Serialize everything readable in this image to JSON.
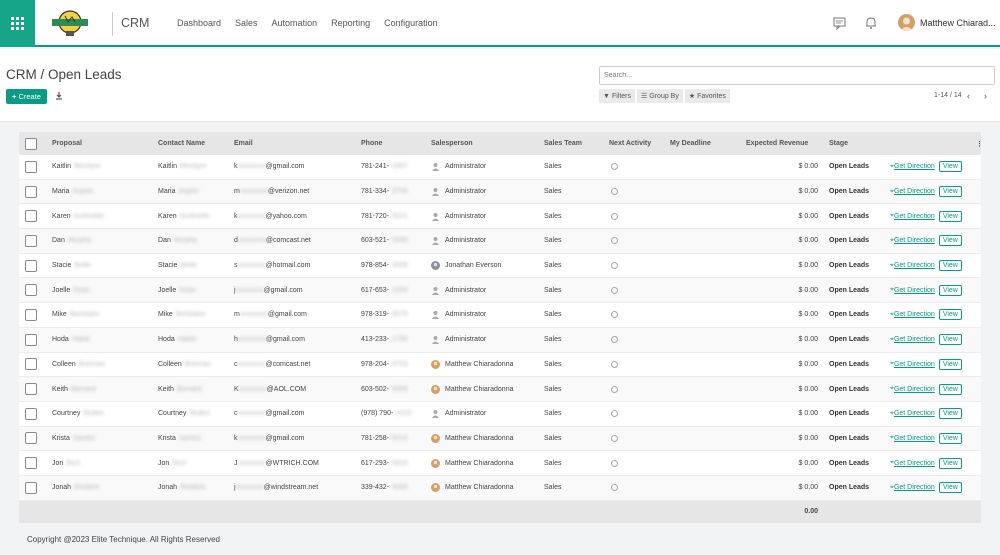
{
  "app": {
    "name": "CRM"
  },
  "nav": {
    "items": [
      "Dashboard",
      "Sales",
      "Automation",
      "Reporting",
      "Configuration"
    ]
  },
  "user": {
    "name": "Matthew Chiarad..."
  },
  "control": {
    "breadcrumb": "CRM / Open Leads",
    "create_label": "Create",
    "search_placeholder": "Search...",
    "filters_label": "Filters",
    "group_by_label": "Group By",
    "favorites_label": "Favorites",
    "pager": "1-14 / 14"
  },
  "table": {
    "columns": [
      "Proposal",
      "Contact Name",
      "Email",
      "Phone",
      "Salesperson",
      "Sales Team",
      "Next Activity",
      "My Deadline",
      "Expected Revenue",
      "Stage"
    ],
    "rows": [
      {
        "first": "Kaitlin",
        "last": "Mcintyre",
        "email_a": "k",
        "email_b": "",
        "email_c": "@gmail.com",
        "phone": "781-241-",
        "phone_b": "3307",
        "salesperson": "Administrator",
        "avatar": "default",
        "team": "Sales",
        "revenue": "$ 0.00",
        "stage": "Open Leads"
      },
      {
        "first": "Maria",
        "last": "Argolo",
        "email_a": "m",
        "email_b": "",
        "email_c": "@verizon.net",
        "phone": "781-334-",
        "phone_b": "0756",
        "salesperson": "Administrator",
        "avatar": "default",
        "team": "Sales",
        "revenue": "$ 0.00",
        "stage": "Open Leads"
      },
      {
        "first": "Karen",
        "last": "Guilmette",
        "email_a": "k",
        "email_b": "",
        "email_c": "@yahoo.com",
        "phone": "781-720-",
        "phone_b": "5021",
        "salesperson": "Administrator",
        "avatar": "default",
        "team": "Sales",
        "revenue": "$ 0.00",
        "stage": "Open Leads"
      },
      {
        "first": "Dan",
        "last": "Murphy",
        "email_a": "d",
        "email_b": "",
        "email_c": "@comcast.net",
        "phone": "603-521-",
        "phone_b": "5585",
        "salesperson": "Administrator",
        "avatar": "default",
        "team": "Sales",
        "revenue": "$ 0.00",
        "stage": "Open Leads"
      },
      {
        "first": "Stacie",
        "last": "Botte",
        "email_a": "s",
        "email_b": "",
        "email_c": "@hotmail.com",
        "phone": "978-854-",
        "phone_b": "3008",
        "salesperson": "Jonathan Everson",
        "avatar": "jonathan",
        "team": "Sales",
        "revenue": "$ 0.00",
        "stage": "Open Leads"
      },
      {
        "first": "Joelle",
        "last": "Dean",
        "email_a": "j",
        "email_b": "",
        "email_c": "@gmail.com",
        "phone": "617-653-",
        "phone_b": "1550",
        "salesperson": "Administrator",
        "avatar": "default",
        "team": "Sales",
        "revenue": "$ 0.00",
        "stage": "Open Leads"
      },
      {
        "first": "Mike",
        "last": "Bertolami",
        "email_a": "m",
        "email_b": "",
        "email_c": "@gmail.com",
        "phone": "978-319-",
        "phone_b": "9575",
        "salesperson": "Administrator",
        "avatar": "default",
        "team": "Sales",
        "revenue": "$ 0.00",
        "stage": "Open Leads"
      },
      {
        "first": "Hoda",
        "last": "Habib",
        "email_a": "h",
        "email_b": "",
        "email_c": "@gmail.com",
        "phone": "413-233-",
        "phone_b": "1790",
        "salesperson": "Administrator",
        "avatar": "default",
        "team": "Sales",
        "revenue": "$ 0.00",
        "stage": "Open Leads"
      },
      {
        "first": "Colleen",
        "last": "Brennan",
        "email_a": "c",
        "email_b": "",
        "email_c": "@comcast.net",
        "phone": "978-204-",
        "phone_b": "6703",
        "salesperson": "Matthew Chiaradonna",
        "avatar": "matthew",
        "team": "Sales",
        "revenue": "$ 0.00",
        "stage": "Open Leads"
      },
      {
        "first": "Keith",
        "last": "Bernard",
        "email_a": "K",
        "email_b": "",
        "email_c": "@AOL.COM",
        "phone": "603-502-",
        "phone_b": "4000",
        "salesperson": "Matthew Chiaradonna",
        "avatar": "matthew",
        "team": "Sales",
        "revenue": "$ 0.00",
        "stage": "Open Leads"
      },
      {
        "first": "Courtney",
        "last": "Mullen",
        "email_a": "c",
        "email_b": "",
        "email_c": "@gmail.com",
        "phone": "(978) 790-",
        "phone_b": "4110",
        "salesperson": "Administrator",
        "avatar": "default",
        "team": "Sales",
        "revenue": "$ 0.00",
        "stage": "Open Leads"
      },
      {
        "first": "Krista",
        "last": "Santos",
        "email_a": "k",
        "email_b": "",
        "email_c": "@gmail.com",
        "phone": "781-258-",
        "phone_b": "9210",
        "salesperson": "Matthew Chiaradonna",
        "avatar": "matthew",
        "team": "Sales",
        "revenue": "$ 0.00",
        "stage": "Open Leads"
      },
      {
        "first": "Jon",
        "last": "Rich",
        "email_a": "J",
        "email_b": "",
        "email_c": "@WTRICH.COM",
        "phone": "617-293-",
        "phone_b": "6820",
        "salesperson": "Matthew Chiaradonna",
        "avatar": "matthew",
        "team": "Sales",
        "revenue": "$ 0.00",
        "stage": "Open Leads"
      },
      {
        "first": "Jonah",
        "last": "Reddick",
        "email_a": "j",
        "email_b": "",
        "email_c": "@windstream.net",
        "phone": "339-432-",
        "phone_b": "4085",
        "salesperson": "Matthew Chiaradonna",
        "avatar": "matthew",
        "team": "Sales",
        "revenue": "$ 0.00",
        "stage": "Open Leads"
      }
    ],
    "direction_label": "Get Direction",
    "view_label": "View",
    "total_revenue": "0.00"
  },
  "footer": {
    "text": "Copyright @2023 Elite Technique. All Rights Reserved"
  },
  "colors": {
    "brand": "#0a9b84",
    "brand_dark": "#17a589"
  }
}
